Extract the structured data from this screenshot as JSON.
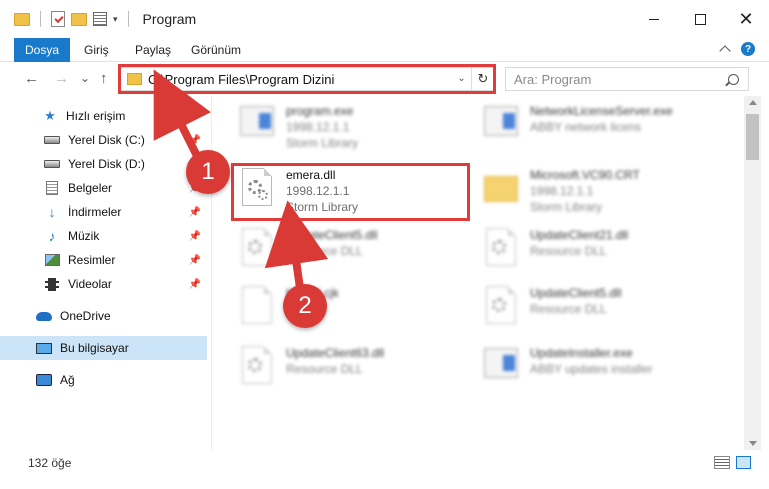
{
  "window": {
    "title": "Program",
    "min_icon": "minimize-icon",
    "max_icon": "maximize-icon",
    "close_glyph": "✕"
  },
  "ribbon": {
    "file_tab": "Dosya",
    "tabs": [
      "Giriş",
      "Paylaş",
      "Görünüm"
    ]
  },
  "nav": {
    "back": "←",
    "forward": "→",
    "recent": "⌄",
    "up": "↑",
    "address": "C:\\Program Files\\Program Dizini",
    "refresh": "↻",
    "search_placeholder": "Ara: Program"
  },
  "sidebar": {
    "items": [
      {
        "label": "Hızlı erişim",
        "icon": "star-icon"
      },
      {
        "label": "Yerel Disk (C:)",
        "icon": "drive-icon",
        "pinned": true
      },
      {
        "label": "Yerel Disk (D:)",
        "icon": "drive-icon",
        "pinned": true
      },
      {
        "label": "Belgeler",
        "icon": "documents-icon",
        "pinned": true
      },
      {
        "label": "İndirmeler",
        "icon": "downloads-icon",
        "pinned": true
      },
      {
        "label": "Müzik",
        "icon": "music-icon",
        "pinned": true
      },
      {
        "label": "Resimler",
        "icon": "pictures-icon",
        "pinned": true
      },
      {
        "label": "Videolar",
        "icon": "videos-icon",
        "pinned": true
      },
      {
        "label": "OneDrive",
        "icon": "onedrive-icon"
      },
      {
        "label": "Bu bilgisayar",
        "icon": "computer-icon",
        "selected": true
      },
      {
        "label": "Ağ",
        "icon": "network-icon"
      }
    ]
  },
  "files": [
    {
      "name": "program.exe",
      "line2": "1998.12.1.1",
      "line3": "Storm Library",
      "icon": "exe-icon",
      "blurred": true
    },
    {
      "name": "NetworkLicenseServer.exe",
      "line2": "ABBY network licens",
      "line3": "",
      "icon": "exe-icon",
      "blurred": true
    },
    {
      "name": "emera.dll",
      "line2": "1998.12.1.1",
      "line3": "Storm Library",
      "icon": "dll-file-icon",
      "blurred": false
    },
    {
      "name": "Microsoft.VC90.CRT",
      "line2": "1998.12.1.1",
      "line3": "Storm Library",
      "icon": "folder-icon",
      "blurred": true
    },
    {
      "name": "UpdateClient5.dll",
      "line2": "Resource DLL",
      "line3": "",
      "icon": "dll-file-icon",
      "blurred": true
    },
    {
      "name": "UpdateClient21.dll",
      "line2": "Resource DLL",
      "line3": "",
      "icon": "dll-file-icon",
      "blurred": true
    },
    {
      "name": "Kernel.cjk",
      "line2": "",
      "line3": "",
      "icon": "file-icon",
      "blurred": true
    },
    {
      "name": "UpdateClient5.dll",
      "line2": "Resource DLL",
      "line3": "",
      "icon": "dll-file-icon",
      "blurred": true
    },
    {
      "name": "UpdateClient63.dll",
      "line2": "Resource DLL",
      "line3": "",
      "icon": "dll-file-icon",
      "blurred": true
    },
    {
      "name": "UpdateInstaller.exe",
      "line2": "ABBY updates installer",
      "line3": "",
      "icon": "exe-icon",
      "blurred": true
    }
  ],
  "status": {
    "count": "132 öğe"
  },
  "annotations": {
    "step1": "1",
    "step2": "2",
    "color": "#d93a36"
  },
  "colors": {
    "accent": "#1979ca",
    "selection": "#cce4f7"
  }
}
